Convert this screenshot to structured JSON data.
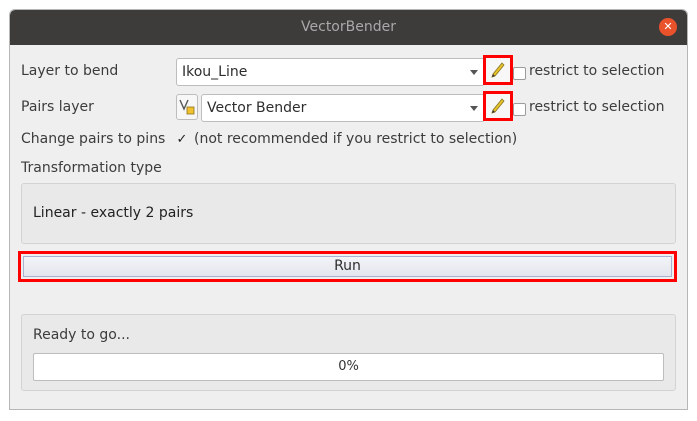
{
  "window": {
    "title": "VectorBender"
  },
  "layer_to_bend": {
    "label": "Layer to bend",
    "value": "Ikou_Line",
    "restrict_label": "restrict to selection",
    "restrict_checked": false
  },
  "pairs_layer": {
    "label": "Pairs layer",
    "value": "Vector Bender",
    "restrict_label": "restrict to selection",
    "restrict_checked": false
  },
  "change_pairs": {
    "label": "Change pairs to pins",
    "checked": true,
    "note": "(not recommended if you restrict to selection)"
  },
  "transformation": {
    "label": "Transformation type",
    "value": "Linear - exactly 2 pairs"
  },
  "run_button": {
    "label": "Run"
  },
  "status": {
    "text": "Ready to go...",
    "progress_text": "0%",
    "progress_fraction": 0
  },
  "colors": {
    "titlebar": "#3d3c3b",
    "close": "#e9522a",
    "highlight": "#ff0000"
  }
}
